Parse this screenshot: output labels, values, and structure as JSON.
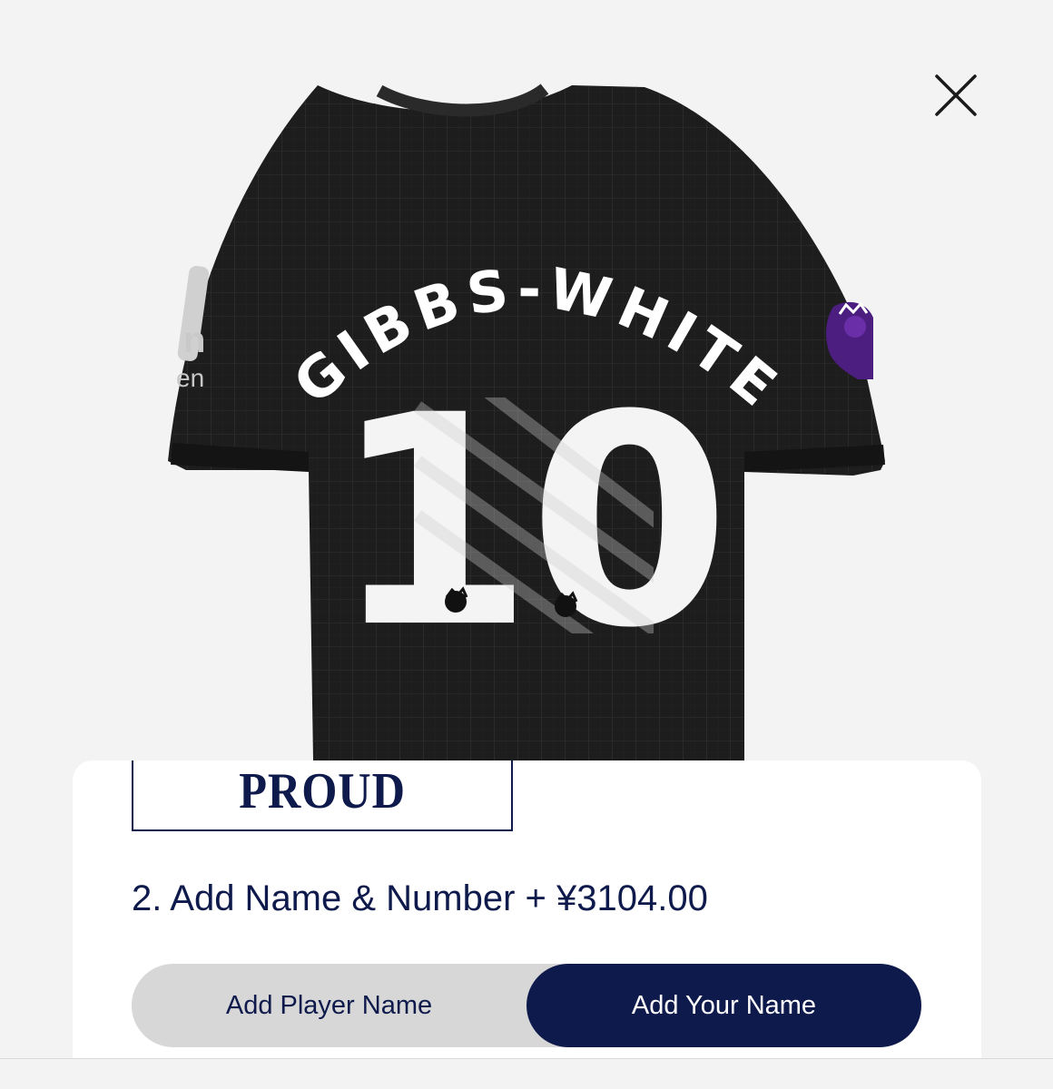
{
  "close": {
    "label": "×"
  },
  "shirt": {
    "player_name": "GIBBS-WHITE",
    "number": "10",
    "sponsor_fragment": "n",
    "sponsor_fragment_small": "en"
  },
  "panel": {
    "card_text": "PROUD",
    "step_title": "2. Add Name & Number + ¥3104.00",
    "options": {
      "player": "Add Player Name",
      "yours": "Add Your Name"
    },
    "selected": "yours"
  },
  "colors": {
    "navy": "#0e1a4b",
    "shirt": "#1d1d1d",
    "premier_purple": "#4b1e7f",
    "toggle_bg": "#d7d7d7"
  }
}
